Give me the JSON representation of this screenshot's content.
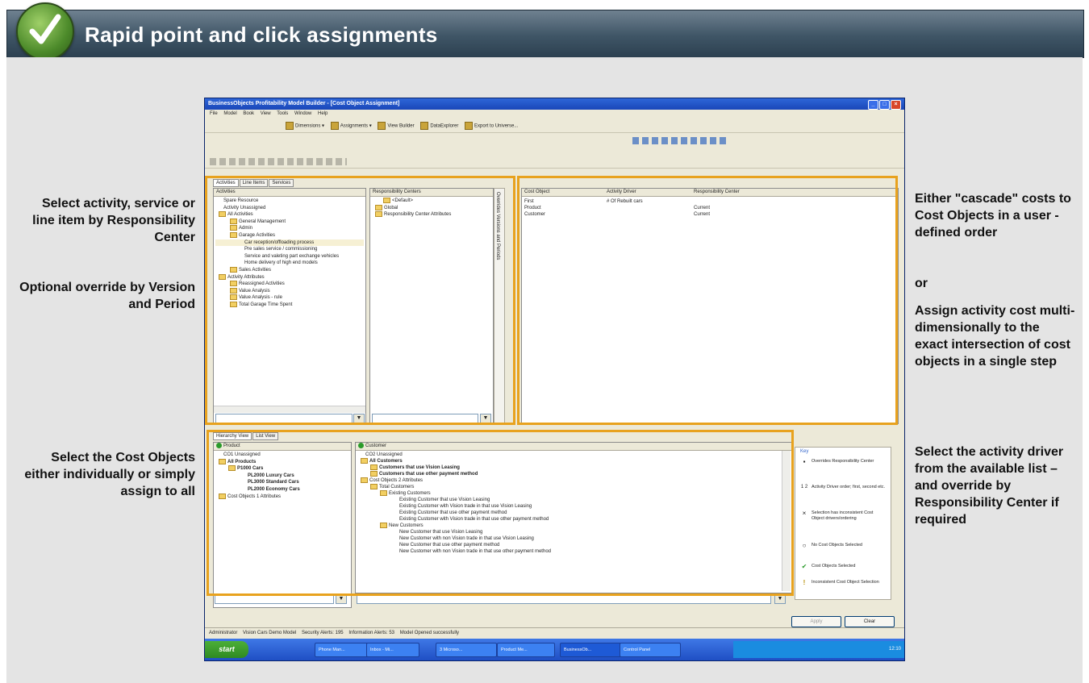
{
  "slide": {
    "title": "Rapid point and click assignments",
    "callouts_left": [
      "Select activity, service or line item by Responsibility Center",
      "Optional override by Version and Period",
      "Select the Cost Objects either individually or simply assign to all"
    ],
    "callouts_right": [
      "Either \"cascade\" costs to Cost Objects in a user - defined order",
      "or",
      "Assign activity cost multi-dimensionally to the exact intersection of cost objects in a single step",
      "Select the activity driver from the available list – and override by Responsibility Center if required"
    ]
  },
  "window": {
    "title": "BusinessObjects Profitability Model Builder - [Cost Object Assignment]",
    "minimize": "_",
    "maximize": "□",
    "close": "×",
    "menu": [
      "File",
      "Model",
      "Book",
      "View",
      "Tools",
      "Window",
      "Help"
    ],
    "toolbar": [
      "Dimensions ▾",
      "Assignments ▾",
      "View Builder",
      "DataExplorer",
      "Export to Universe..."
    ]
  },
  "activities_panel": {
    "tabs": [
      "Activities",
      "Line Items",
      "Services"
    ],
    "header": "Activities",
    "tree": [
      "Spare Resource",
      "Activity Unassigned",
      "All Activities",
      "General Management",
      "Admin",
      "Garage Activities",
      "Car reception/offloading process",
      "Pre sales service / commissioning",
      "Service and valeting part exchange vehicles",
      "Home delivery of high end models",
      "Sales Activities",
      "Activity Attributes",
      "Reassigned Activities",
      "Value Analysis",
      "Value Analysis - rule",
      "Total Garage Time Spent"
    ]
  },
  "resp_panel": {
    "header": "Responsibility Centers",
    "tree": [
      "<Default>",
      "Global",
      "Responsibility Center Attributes"
    ],
    "side_label": "Overrides Versions and Periods"
  },
  "assign_grid": {
    "columns": [
      "Cost Object",
      "Activity Driver",
      "Responsibility Center"
    ],
    "rows": [
      [
        "First",
        "# Of Rebuilt cars",
        ""
      ],
      [
        "Product",
        "",
        "Current"
      ],
      [
        "Customer",
        "",
        "Current"
      ]
    ]
  },
  "product_panel": {
    "tabs": [
      "Hierarchy View",
      "List View"
    ],
    "header": "Product",
    "tree": [
      "CO1 Unassigned",
      "All Products",
      "P1000 Cars",
      "PL2000 Luxury Cars",
      "PL3000 Standard Cars",
      "PL2000 Economy Cars",
      "Cost Objects 1 Attributes"
    ]
  },
  "customer_panel": {
    "header": "Customer",
    "tree": [
      "CO2 Unassigned",
      "All Customers",
      "Customers that use Vision Leasing",
      "Customers that use other payment method",
      "Cost Objects 2 Attributes",
      "Total Customers",
      "Existing Customers",
      "Existing Customer that use Vision Leasing",
      "Existing Customer with Vision trade in that use Vision Leasing",
      "Existing Customer that use other payment method",
      "Existing Customer with Vision trade in that use other payment method",
      "New Customers",
      "New Customer that use Vision Leasing",
      "New Customer with non Vision trade in that use Vision Leasing",
      "New Customer that use other payment method",
      "New Customer with non Vision trade in that use other payment method"
    ]
  },
  "key": {
    "title": "Key",
    "items": [
      {
        "symbol": "▪",
        "text": "Overrides Responsibility Center"
      },
      {
        "symbol": "1 2",
        "text": "Activity Driver order; first, second etc."
      },
      {
        "symbol": "×",
        "text": "Selection has inconsistent Cost Object drivers/ordering"
      },
      {
        "symbol": "○",
        "text": "No Cost Objects Selected"
      },
      {
        "symbol": "✔",
        "text": "Cost Objects Selected"
      },
      {
        "symbol": "!",
        "text": "Inconsistent Cost Object Selection"
      }
    ]
  },
  "buttons": {
    "apply": "Apply",
    "clear": "Clear"
  },
  "status": [
    "Administrator",
    "Vision Cars Demo Model",
    "Security Alerts: 195",
    "Information Alerts: 53",
    "Model Opened successfully"
  ],
  "taskbar": {
    "start": "start",
    "tasks": [
      "Phone Man...",
      "Inbox - Mi...",
      "3 Microso...",
      "Product Me...",
      "BusinessOb...",
      "Control Panel"
    ],
    "clock": "12:10"
  },
  "colors": {
    "highlight": "#e8a21e",
    "header_bar": "#3f5566",
    "xp_blue": "#1f4fc4"
  }
}
